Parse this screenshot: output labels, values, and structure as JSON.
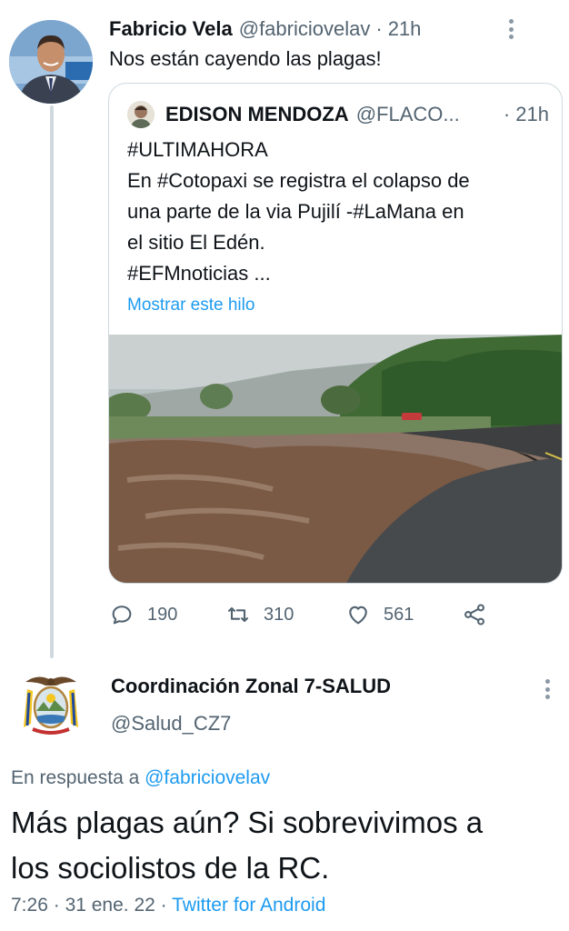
{
  "parent_tweet": {
    "author_name": "Fabricio Vela",
    "handle": "@fabriciovelav",
    "separator": "·",
    "time": "21h",
    "text": "Nos están cayendo las plagas!",
    "quoted_tweet": {
      "author_name": "EDISON MENDOZA",
      "handle": "@FLACO...",
      "separator": "·",
      "time": "21h",
      "lines": [
        "#ULTIMAHORA",
        "En #Cotopaxi se registra el colapso de",
        "una parte de la via  Pujilí -#LaMana en",
        "el sitio El Edén.",
        "#EFMnoticias ..."
      ],
      "show_thread": "Mostrar este hilo",
      "media_icon": "flooded-road-photo"
    },
    "actions": {
      "reply_icon": "reply-icon",
      "replies": "190",
      "retweet_icon": "retweet-icon",
      "retweets": "310",
      "like_icon": "heart-icon",
      "likes": "561",
      "share_icon": "share-icon"
    }
  },
  "reply_tweet": {
    "author_name": "Coordinación Zonal 7-SALUD",
    "handle": "@Salud_CZ7",
    "avatar_icon": "ecuador-coat-of-arms",
    "reply_prefix": "En respuesta a",
    "reply_mention": "@fabriciovelav",
    "text_lines": [
      "Más plagas aún? Si sobrevivimos a",
      "los sociolistos de la RC."
    ],
    "time": "7:26",
    "separator": "·",
    "date": "31 ene. 22",
    "separator2": "·",
    "source": "Twitter for Android"
  },
  "colors": {
    "link": "#1d9bf0",
    "secondary_text": "#536471",
    "border": "#cfd9de",
    "thread_line": "#cfd9de"
  }
}
